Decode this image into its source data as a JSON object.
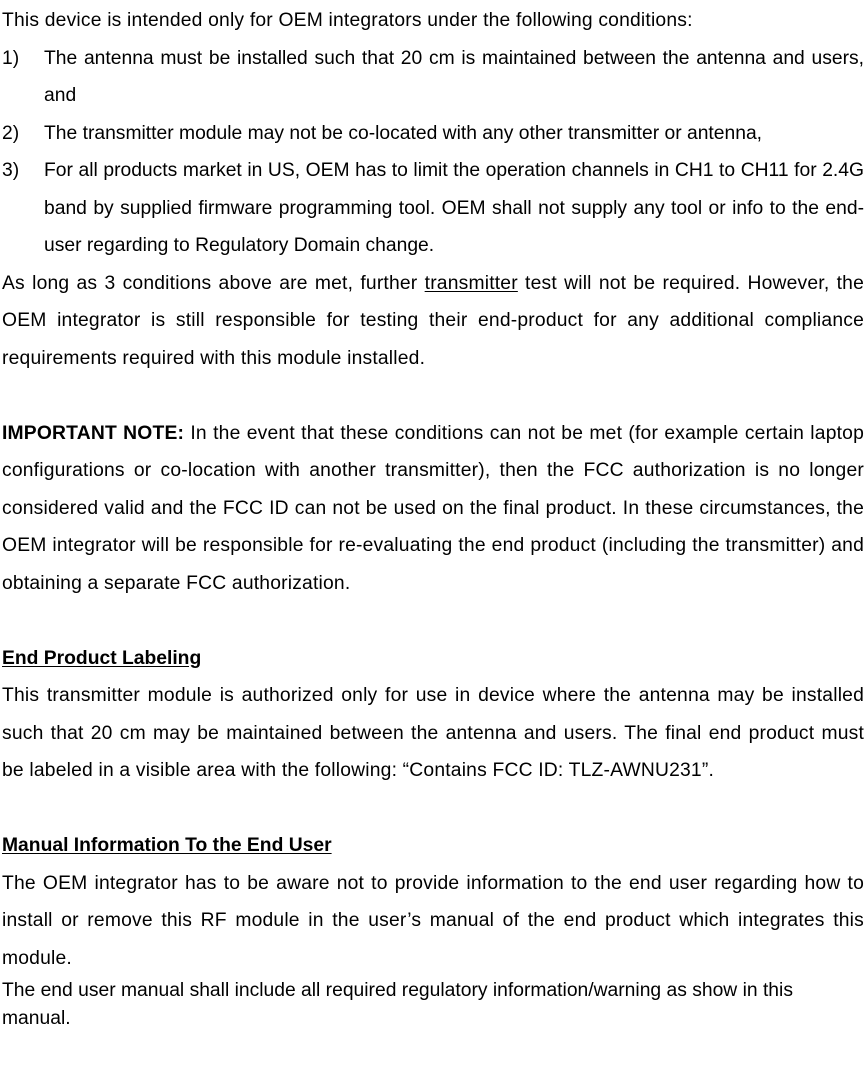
{
  "document": {
    "intro_paragraph": "This device is intended only for OEM integrators under the following conditions:",
    "conditions": [
      {
        "marker": "1)",
        "text": "The antenna must be installed such that 20 cm is maintained between the antenna and users, and"
      },
      {
        "marker": "2)",
        "text": "The transmitter module may not be co-located with any other transmitter or antenna,"
      },
      {
        "marker": "3)",
        "text": "For all products market in US, OEM has to limit the operation channels in CH1 to CH11 for 2.4G band by supplied firmware programming tool. OEM shall not supply any tool or info to the end-user regarding to Regulatory Domain change."
      }
    ],
    "conditions_summary": {
      "before_underline": "As long as 3 conditions above are met, further ",
      "underlined_word": "transmitter",
      "after_underline": " test will not be required. However, the OEM integrator is still responsible for testing their end-product for any additional compliance requirements required with this module installed."
    },
    "important_note": {
      "label": "IMPORTANT NOTE:",
      "text": " In the event that these conditions can not be met (for example certain laptop configurations or co-location with another transmitter), then the FCC authorization is no longer considered valid and the FCC ID can not be used on the final product. In these circumstances, the OEM integrator will be responsible for re-evaluating the end product (including the transmitter) and obtaining a separate FCC authorization."
    },
    "end_product_labeling": {
      "heading": "End Product Labeling",
      "body": "This transmitter module is authorized only for use in device where the antenna may be installed such that 20 cm may be maintained between the antenna and users. The final end product must be labeled in a visible area with the following: “Contains FCC ID: TLZ-AWNU231”.",
      "fcc_id": "TLZ-AWNU231"
    },
    "manual_information": {
      "heading": "Manual Information To the End User",
      "body": "The OEM integrator has to be aware not to provide information to the end user regarding how to install or remove this RF module in the user’s manual of the end product which integrates this module.",
      "body_secondary": "The end user manual shall include all required regulatory information/warning as show in this manual."
    }
  }
}
